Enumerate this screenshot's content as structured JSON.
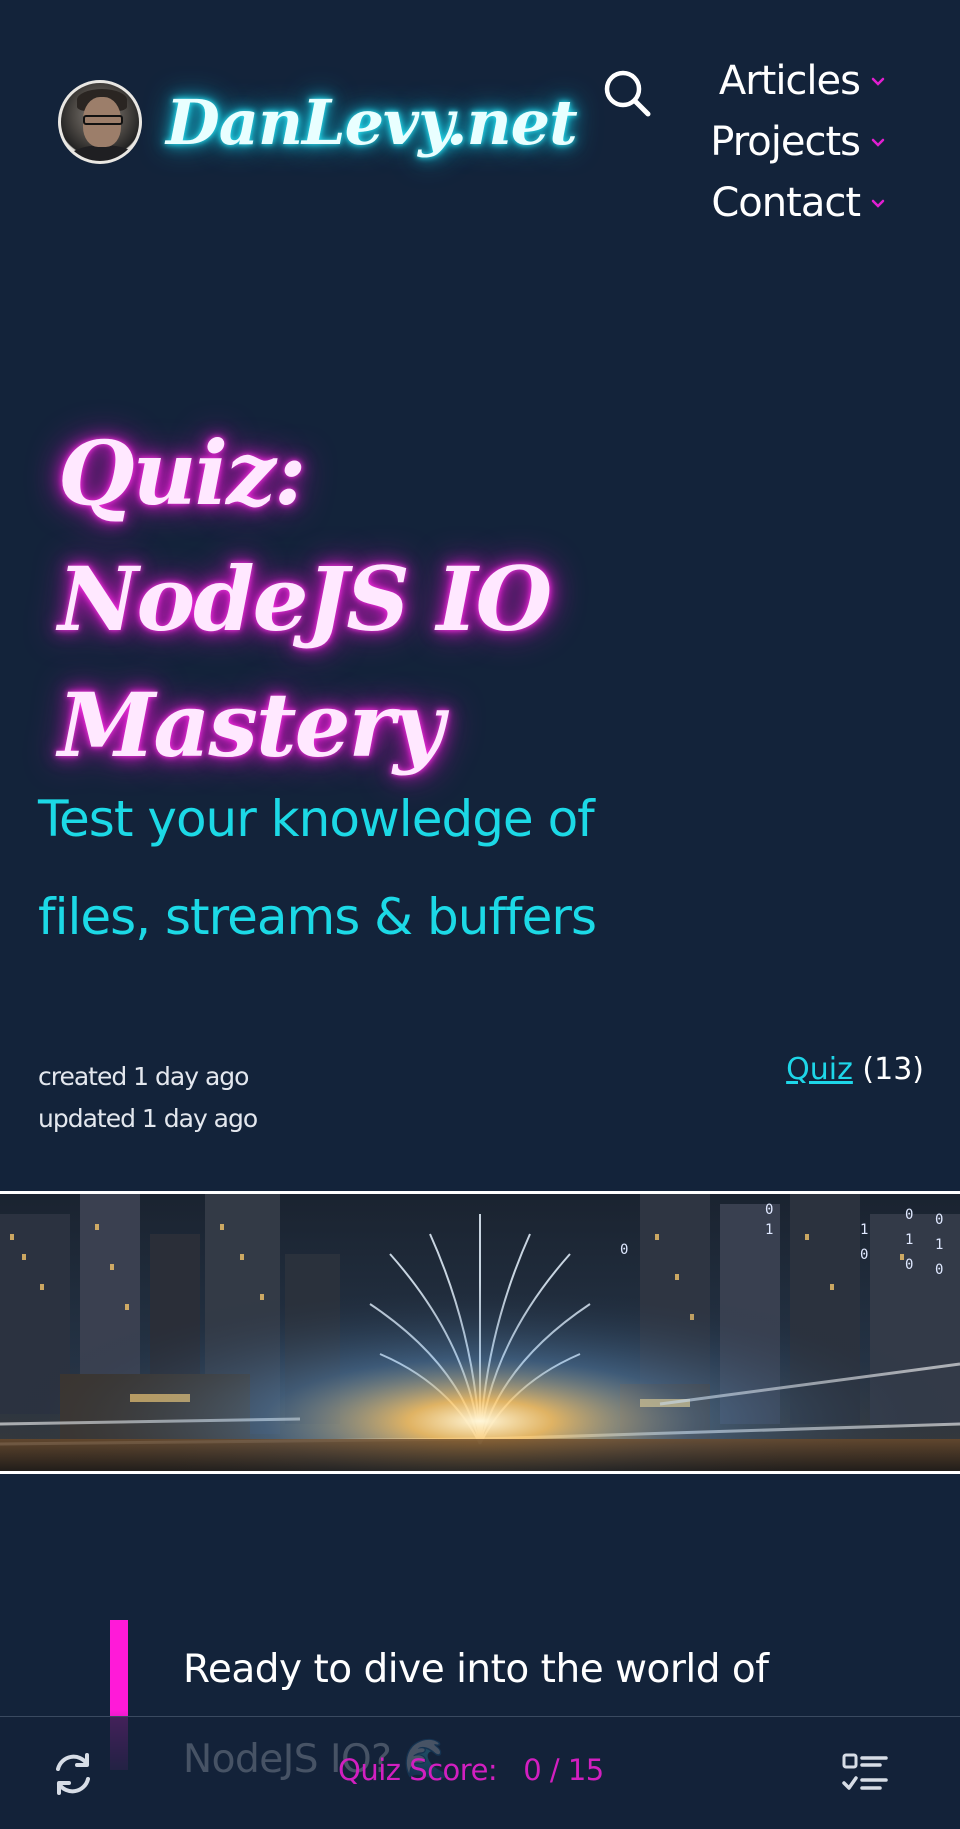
{
  "header": {
    "site_name": "DanLevy.net",
    "nav": [
      {
        "label": "Articles"
      },
      {
        "label": "Projects"
      },
      {
        "label": "Contact"
      }
    ]
  },
  "hero": {
    "title": "Quiz: NodeJS IO Mastery",
    "subtitle": "Test your knowledge of files, streams & buffers",
    "created": "created 1 day ago",
    "updated": "updated 1 day ago",
    "tag_label": "Quiz",
    "tag_count": "(13)"
  },
  "intro": {
    "text": "Ready to dive into the world of NodeJS IO? 🌊"
  },
  "quiz_bar": {
    "score_label": "Quiz Score:",
    "score_value": "0 / 15"
  },
  "colors": {
    "background": "#13233a",
    "cyan_accent": "#1cd9e6",
    "magenta_accent": "#ff1ad8",
    "score_color": "#d21fc0"
  },
  "icons": {
    "search": "search-icon",
    "chevron": "chevron-down-icon",
    "reset": "refresh-icon",
    "question_list": "checklist-icon"
  }
}
